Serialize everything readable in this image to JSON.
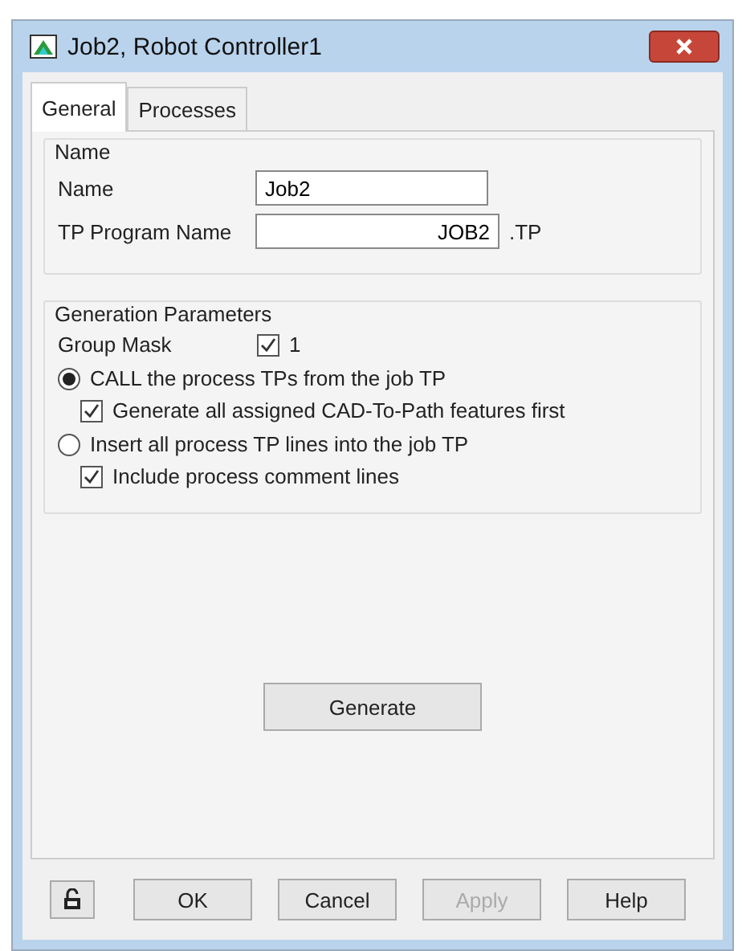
{
  "window": {
    "title": "Job2, Robot Controller1"
  },
  "tabs": [
    {
      "label": "General",
      "selected": true
    },
    {
      "label": "Processes",
      "selected": false
    }
  ],
  "name_group": {
    "title": "Name",
    "name_label": "Name",
    "name_value": "Job2",
    "tp_label": "TP Program Name",
    "tp_value": "JOB2",
    "tp_suffix": ".TP"
  },
  "generation": {
    "title": "Generation Parameters",
    "group_mask_label": "Group Mask",
    "group_mask_checked": true,
    "group_mask_value": "1",
    "options": [
      {
        "label": "CALL the process TPs from the job TP",
        "selected": true,
        "sub": {
          "label": "Generate all assigned CAD-To-Path features first",
          "checked": true
        }
      },
      {
        "label": "Insert all process TP lines into the job TP",
        "selected": false,
        "sub": {
          "label": "Include process comment lines",
          "checked": true
        }
      }
    ]
  },
  "generate_button": "Generate",
  "buttons": [
    {
      "label": "OK",
      "disabled": false
    },
    {
      "label": "Cancel",
      "disabled": false
    },
    {
      "label": "Apply",
      "disabled": true
    },
    {
      "label": "Help",
      "disabled": false
    }
  ]
}
